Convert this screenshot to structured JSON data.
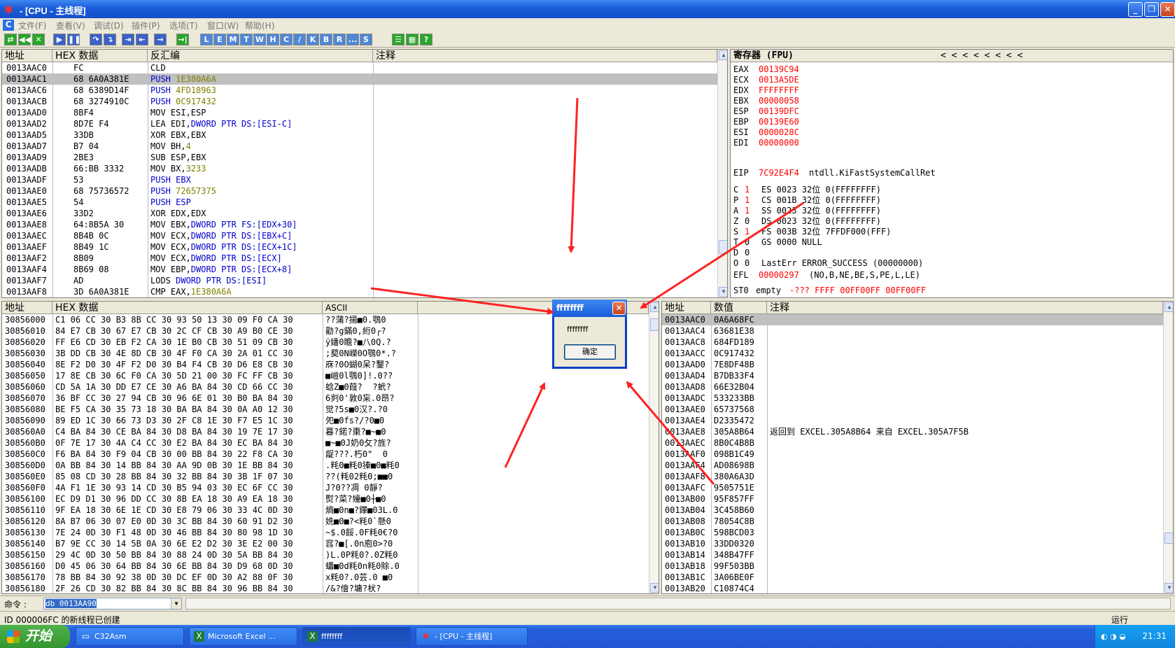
{
  "window": {
    "title": "  -  [CPU - 主线程]",
    "controls": {
      "minimize": "_",
      "restore": "❐",
      "close": "✕"
    }
  },
  "menu": [
    "文件(F)",
    "查看(V)",
    "调试(D)",
    "插件(P)",
    "选项(T)",
    "窗口(W)",
    "帮助(H)"
  ],
  "toolbar": {
    "group1": [
      "⇄",
      "◀◀",
      "✕"
    ],
    "group2": [
      "▶",
      "❚❚"
    ],
    "group3": [
      "↷",
      "↴",
      "⇥",
      "⇤",
      "→"
    ],
    "group4": [
      "→|"
    ],
    "letters": [
      "L",
      "E",
      "M",
      "T",
      "W",
      "H",
      "C",
      "/",
      "K",
      "B",
      "R",
      "...",
      "S"
    ],
    "group5": [
      "☰",
      "▦",
      "?"
    ]
  },
  "disasm": {
    "headers": {
      "addr": "地址",
      "hex": "HEX 数据",
      "dis": "反汇编",
      "cmt": "注释"
    },
    "rows": [
      {
        "addr": "0013AAC0",
        "hex": "FC",
        "op": "CLD",
        "args": ""
      },
      {
        "addr": "0013AAC1",
        "hex": "68 6A0A381E",
        "op": "PUSH",
        "args": "1E380A6A"
      },
      {
        "addr": "0013AAC6",
        "hex": "68 6389D14F",
        "op": "PUSH",
        "args": "4FD18963"
      },
      {
        "addr": "0013AACB",
        "hex": "68 3274910C",
        "op": "PUSH",
        "args": "0C917432"
      },
      {
        "addr": "0013AAD0",
        "hex": "8BF4",
        "op": "MOV ESI,ESP",
        "args": ""
      },
      {
        "addr": "0013AAD2",
        "hex": "8D7E F4",
        "op": "LEA EDI,",
        "args": "DWORD PTR DS:[ESI-C]"
      },
      {
        "addr": "0013AAD5",
        "hex": "33DB",
        "op": "XOR EBX,EBX",
        "args": ""
      },
      {
        "addr": "0013AAD7",
        "hex": "B7 04",
        "op": "MOV BH,",
        "args": "4"
      },
      {
        "addr": "0013AAD9",
        "hex": "2BE3",
        "op": "SUB ESP,EBX",
        "args": ""
      },
      {
        "addr": "0013AADB",
        "hex": "66:BB 3332",
        "op": "MOV BX,",
        "args": "3233"
      },
      {
        "addr": "0013AADF",
        "hex": "53",
        "op": "PUSH",
        "args": "EBX"
      },
      {
        "addr": "0013AAE0",
        "hex": "68 75736572",
        "op": "PUSH",
        "args": "72657375"
      },
      {
        "addr": "0013AAE5",
        "hex": "54",
        "op": "PUSH",
        "args": "ESP"
      },
      {
        "addr": "0013AAE6",
        "hex": "33D2",
        "op": "XOR EDX,EDX",
        "args": ""
      },
      {
        "addr": "0013AAE8",
        "hex": "64:8B5A 30",
        "op": "MOV EBX,",
        "args": "DWORD PTR FS:[EDX+30]"
      },
      {
        "addr": "0013AAEC",
        "hex": "8B4B 0C",
        "op": "MOV ECX,",
        "args": "DWORD PTR DS:[EBX+C]"
      },
      {
        "addr": "0013AAEF",
        "hex": "8B49 1C",
        "op": "MOV ECX,",
        "args": "DWORD PTR DS:[ECX+1C]"
      },
      {
        "addr": "0013AAF2",
        "hex": "8B09",
        "op": "MOV ECX,",
        "args": "DWORD PTR DS:[ECX]"
      },
      {
        "addr": "0013AAF4",
        "hex": "8B69 08",
        "op": "MOV EBP,",
        "args": "DWORD PTR DS:[ECX+8]"
      },
      {
        "addr": "0013AAF7",
        "hex": "AD",
        "op": "LODS ",
        "args": "DWORD PTR DS:[ESI]"
      },
      {
        "addr": "0013AAF8",
        "hex": "3D 6A0A381E",
        "op": "CMP EAX,",
        "args": "1E380A6A"
      }
    ]
  },
  "registers": {
    "header": "寄存器 (FPU)",
    "arrows": "<     <     <     <     <     <     <     <",
    "regs": [
      {
        "name": "EAX",
        "val": "00139C94"
      },
      {
        "name": "ECX",
        "val": "0013A5DE"
      },
      {
        "name": "EDX",
        "val": "FFFFFFFF"
      },
      {
        "name": "EBX",
        "val": "00000058"
      },
      {
        "name": "ESP",
        "val": "00139DFC"
      },
      {
        "name": "EBP",
        "val": "00139E60"
      },
      {
        "name": "ESI",
        "val": "0000028C"
      },
      {
        "name": "EDI",
        "val": "00000000"
      }
    ],
    "eip": {
      "name": "EIP",
      "val": "7C92E4F4",
      "note": "ntdll.KiFastSystemCallRet"
    },
    "flags": [
      {
        "f": "C",
        "v": "1",
        "rest": "ES 0023 32位 0(FFFFFFFF)"
      },
      {
        "f": "P",
        "v": "1",
        "rest": "CS 001B 32位 0(FFFFFFFF)"
      },
      {
        "f": "A",
        "v": "1",
        "rest": "SS 0023 32位 0(FFFFFFFF)"
      },
      {
        "f": "Z",
        "v": "0",
        "rest": "DS 0023 32位 0(FFFFFFFF)"
      },
      {
        "f": "S",
        "v": "1",
        "rest": "FS 003B 32位 7FFDF000(FFF)"
      },
      {
        "f": "T",
        "v": "0",
        "rest": "GS 0000 NULL"
      },
      {
        "f": "D",
        "v": "0",
        "rest": ""
      },
      {
        "f": "O",
        "v": "0",
        "rest": "LastErr ERROR_SUCCESS (00000000)"
      }
    ],
    "efl": {
      "name": "EFL",
      "val": "00000297",
      "note": "(NO,B,NE,BE,S,PE,L,LE)"
    },
    "st0": {
      "name": "ST0",
      "note": "empty",
      "val": "-??? FFFF 00FF00FF 00FF00FF"
    }
  },
  "dump": {
    "headers": {
      "addr": "地址",
      "hex": "HEX 数据",
      "ascii": "ASCII"
    },
    "rows": [
      {
        "addr": "30856000",
        "hex": "C1 06 CC 30 B3 8B CC 30 93 50 13 30 09 F0 CA 30",
        "ascii": "??蒲?揚■0.鶚0"
      },
      {
        "addr": "30856010",
        "hex": "84 E7 CB 30 67 E7 CB 30 2C CF CB 30 A9 B0 CE 30",
        "ascii": "勸?g鏋0,絎0┌?"
      },
      {
        "addr": "30856020",
        "hex": "FF E6 CD 30 EB F2 CA 30 1E B0 CB 30 51 09 CB 30",
        "ascii": "ÿ嬏0瞻?■八0Q.?"
      },
      {
        "addr": "30856030",
        "hex": "3B DD CB 30 4E 8D CB 30 4F F0 CA 30 2A 01 CC 30",
        "ascii": ";葜0N嶸0O鶚0*.?"
      },
      {
        "addr": "30856040",
        "hex": "8E F2 D0 30 4F F2 D0 30 B4 F4 CB 30 D6 E8 CB 30",
        "ascii": "庥?0O蝴0呆?鑋?"
      },
      {
        "addr": "30856050",
        "hex": "17 8E CB 30 6C F0 CA 30 5D 21 00 30 FC FF CB 30",
        "ascii": "■嵦0l鶚0]!.0??"
      },
      {
        "addr": "30856060",
        "hex": "CD 5A 1A 30 DD E7 CE 30 A6 BA 84 30 CD 66 CC 30",
        "ascii": "蛿Z■0葭?  ?蚮?"
      },
      {
        "addr": "30856070",
        "hex": "36 BF CC 30 27 94 CB 30 96 6E 01 30 B0 BA 84 30",
        "ascii": "6刿0'敦0杗.0昂?"
      },
      {
        "addr": "30856080",
        "hex": "BE F5 CA 30 35 73 18 30 BA BA 84 30 0A A0 12 30",
        "ascii": "觉?5s■0汉?.?0"
      },
      {
        "addr": "30856090",
        "hex": "89 ED 1C 30 66 73 D3 30 2F C8 1E 30 F7 E5 1C 30",
        "ascii": "夗■0fs?/?0■0"
      },
      {
        "addr": "308560A0",
        "hex": "C4 BA 84 30 CE BA 84 30 D8 BA 84 30 19 7E 17 30",
        "ascii": "暮?鍩?棗?■~■0"
      },
      {
        "addr": "308560B0",
        "hex": "0F 7E 17 30 4A C4 CC 30 E2 BA 84 30 EC BA 84 30",
        "ascii": "■~■0J奶0攵?旌?"
      },
      {
        "addr": "308560C0",
        "hex": "F6 BA 84 30 F9 04 CB 30 00 BB 84 30 22 F8 CA 30",
        "ascii": "龊???.朽0\"  0"
      },
      {
        "addr": "308560D0",
        "hex": "0A BB 84 30 14 BB 84 30 AA 9D 0B 30 1E BB 84 30",
        "ascii": ".粍0■粍0獉■0■粍0"
      },
      {
        "addr": "308560E0",
        "hex": "85 08 CD 30 28 BB 84 30 32 BB 84 30 3B 1F 07 30",
        "ascii": "??(粍02粍0;■■0"
      },
      {
        "addr": "308560F0",
        "hex": "4A F1 1E 30 93 14 CD 30 B5 94 03 30 EC 6F CC 30",
        "ascii": "J?0??凋 0靜?"
      },
      {
        "addr": "30856100",
        "hex": "EC D9 D1 30 96 DD CC 30 8B EA 18 30 A9 EA 18 30",
        "ascii": "熨?菜?嬯■0┼■0"
      },
      {
        "addr": "30856110",
        "hex": "9F EA 18 30 6E 1E CD 30 E8 79 06 30 33 4C 0D 30",
        "ascii": "熵■0n■?鑻■03L.0"
      },
      {
        "addr": "30856120",
        "hex": "8A B7 06 30 07 E0 0D 30 3C BB 84 30 60 91 D2 30",
        "ascii": "姺■0■?<粍0`懸0"
      },
      {
        "addr": "30856130",
        "hex": "7E 24 0D 30 F1 48 0D 30 46 BB 84 30 80 98 1D 30",
        "ascii": "~$.0餒.0F粍0€?0"
      },
      {
        "addr": "30856140",
        "hex": "B7 9E CC 30 14 5B 0A 30 6E E2 D2 30 3E E2 00 30",
        "ascii": "窞?■[.0n庖0>?0"
      },
      {
        "addr": "30856150",
        "hex": "29 4C 0D 30 50 BB 84 30 88 24 0D 30 5A BB 84 30",
        "ascii": ")L.0P粍0?.0Z粍0"
      },
      {
        "addr": "30856160",
        "hex": "D0 45 06 30 64 BB 84 30 6E BB 84 30 D9 68 0D 30",
        "ascii": "蠨■0d粍0n粍0賖.0"
      },
      {
        "addr": "30856170",
        "hex": "78 BB 84 30 92 38 0D 30 DC EF 0D 30 A2 88 0F 30",
        "ascii": "x粍0?.0芸.0 ■0"
      },
      {
        "addr": "30856180",
        "hex": "2F 26 CD 30 82 BB 84 30 8C BB 84 30 96 BB 84 30",
        "ascii": "/&?儈?墉?枤?"
      }
    ]
  },
  "stack": {
    "headers": {
      "addr": "地址",
      "val": "数值",
      "cmt": "注释"
    },
    "rows": [
      {
        "addr": "0013AAC0",
        "val": "0A6A68FC",
        "cmt": ""
      },
      {
        "addr": "0013AAC4",
        "val": "63681E38",
        "cmt": ""
      },
      {
        "addr": "0013AAC8",
        "val": "684FD189",
        "cmt": ""
      },
      {
        "addr": "0013AACC",
        "val": "0C917432",
        "cmt": ""
      },
      {
        "addr": "0013AAD0",
        "val": "7E8DF48B",
        "cmt": ""
      },
      {
        "addr": "0013AAD4",
        "val": "B7DB33F4",
        "cmt": ""
      },
      {
        "addr": "0013AAD8",
        "val": "66E32B04",
        "cmt": ""
      },
      {
        "addr": "0013AADC",
        "val": "533233BB",
        "cmt": ""
      },
      {
        "addr": "0013AAE0",
        "val": "65737568",
        "cmt": ""
      },
      {
        "addr": "0013AAE4",
        "val": "D2335472",
        "cmt": ""
      },
      {
        "addr": "0013AAE8",
        "val": "305A8B64",
        "cmt": "返回到 EXCEL.305A8B64 来自 EXCEL.305A7F5B"
      },
      {
        "addr": "0013AAEC",
        "val": "8B0C4B8B",
        "cmt": ""
      },
      {
        "addr": "0013AAF0",
        "val": "098B1C49",
        "cmt": ""
      },
      {
        "addr": "0013AAF4",
        "val": "AD08698B",
        "cmt": ""
      },
      {
        "addr": "0013AAF8",
        "val": "380A6A3D",
        "cmt": ""
      },
      {
        "addr": "0013AAFC",
        "val": "9505751E",
        "cmt": ""
      },
      {
        "addr": "0013AB00",
        "val": "95F857FF",
        "cmt": ""
      },
      {
        "addr": "0013AB04",
        "val": "3C458B60",
        "cmt": ""
      },
      {
        "addr": "0013AB08",
        "val": "78054C8B",
        "cmt": ""
      },
      {
        "addr": "0013AB0C",
        "val": "598BCD03",
        "cmt": ""
      },
      {
        "addr": "0013AB10",
        "val": "33DD0320",
        "cmt": ""
      },
      {
        "addr": "0013AB14",
        "val": "348B47FF",
        "cmt": ""
      },
      {
        "addr": "0013AB18",
        "val": "99F503BB",
        "cmt": ""
      },
      {
        "addr": "0013AB1C",
        "val": "3A06BE0F",
        "cmt": ""
      },
      {
        "addr": "0013AB20",
        "val": "C10874C4",
        "cmt": ""
      }
    ]
  },
  "command": {
    "label": "命令 :",
    "value": "db 0013AA90"
  },
  "status": {
    "text": "ID 000006FC 的新线程已创建",
    "right": "运行"
  },
  "dialog": {
    "title": "ffffffff",
    "message": "ffffffff",
    "ok": "确定"
  },
  "taskbar": {
    "start": "开始",
    "tasks": [
      "C32Asm",
      "Microsoft Excel ...",
      "ffffffff",
      "  -  [CPU - 主线程]"
    ],
    "clock": "21:31"
  },
  "colors": {
    "accent": "#1a5bd8",
    "reg_value": "#ff0000",
    "mnemonic": "#0000cc",
    "immediate": "#808000",
    "arrow": "#ff2222"
  }
}
